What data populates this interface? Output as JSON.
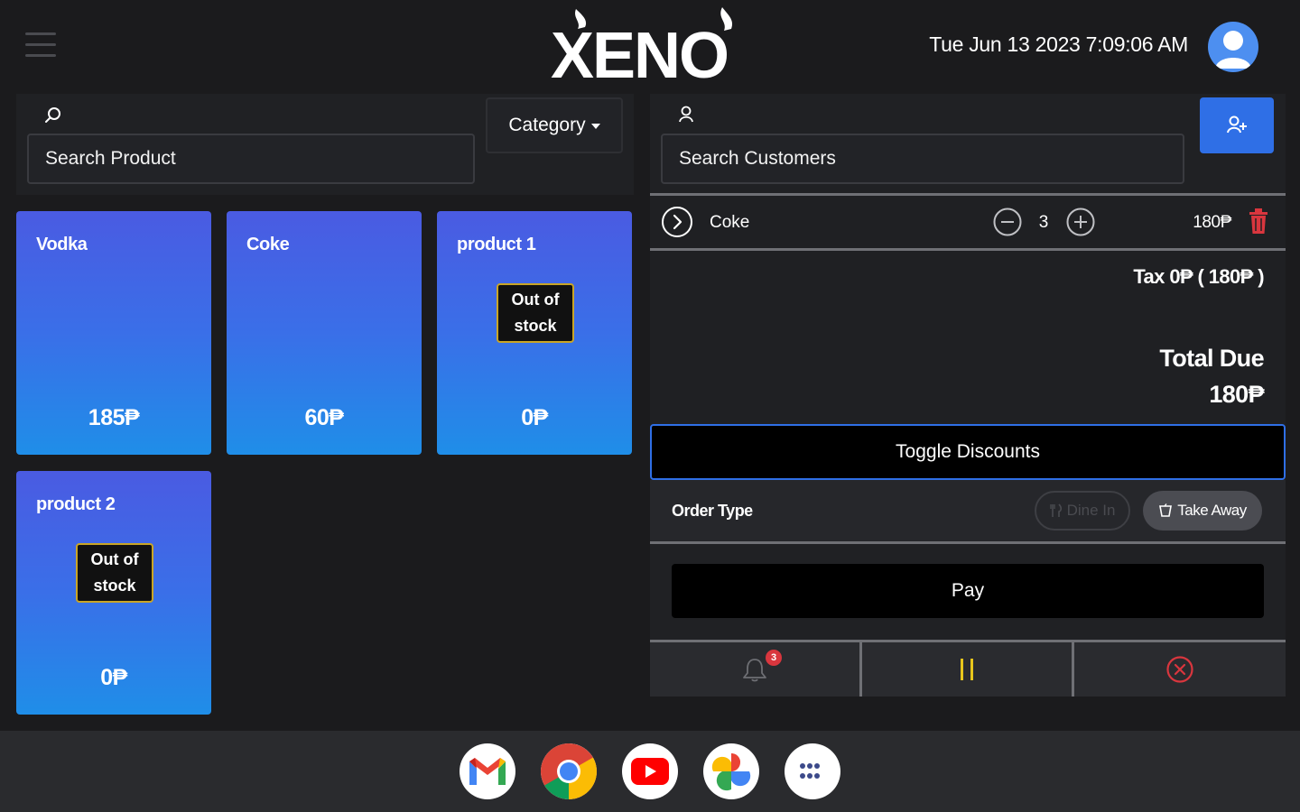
{
  "header": {
    "logo_text": "XENO",
    "datetime": "Tue Jun 13 2023 7:09:06 AM"
  },
  "products_panel": {
    "search_placeholder": "Search Product",
    "category_label": "Category",
    "products": [
      {
        "name": "Vodka",
        "price": "185₱",
        "out_of_stock": false
      },
      {
        "name": "Coke",
        "price": "60₱",
        "out_of_stock": false
      },
      {
        "name": "product 1",
        "price": "0₱",
        "out_of_stock": true,
        "stock_label": "Out of stock"
      },
      {
        "name": "product 2",
        "price": "0₱",
        "out_of_stock": true,
        "stock_label": "Out of stock"
      }
    ]
  },
  "order_panel": {
    "customer_search_placeholder": "Search Customers",
    "line_items": [
      {
        "name": "Coke",
        "quantity": "3",
        "total": "180₱"
      }
    ],
    "tax_text": "Tax 0₱ ( 180₱ )",
    "total_due_label": "Total Due",
    "total_due_value": "180₱",
    "toggle_discounts_label": "Toggle Discounts",
    "order_type_label": "Order Type",
    "dine_in_label": "Dine In",
    "take_away_label": "Take Away",
    "pay_label": "Pay",
    "notification_count": "3"
  },
  "colors": {
    "accent_blue": "#2f6fe6",
    "out_of_stock_border": "#c9a526",
    "hold_yellow": "#e8c61c",
    "cancel_red": "#d9363e"
  },
  "dock": {
    "apps": [
      "gmail-icon",
      "chrome-icon",
      "youtube-icon",
      "photos-icon",
      "app-launcher-icon"
    ]
  }
}
